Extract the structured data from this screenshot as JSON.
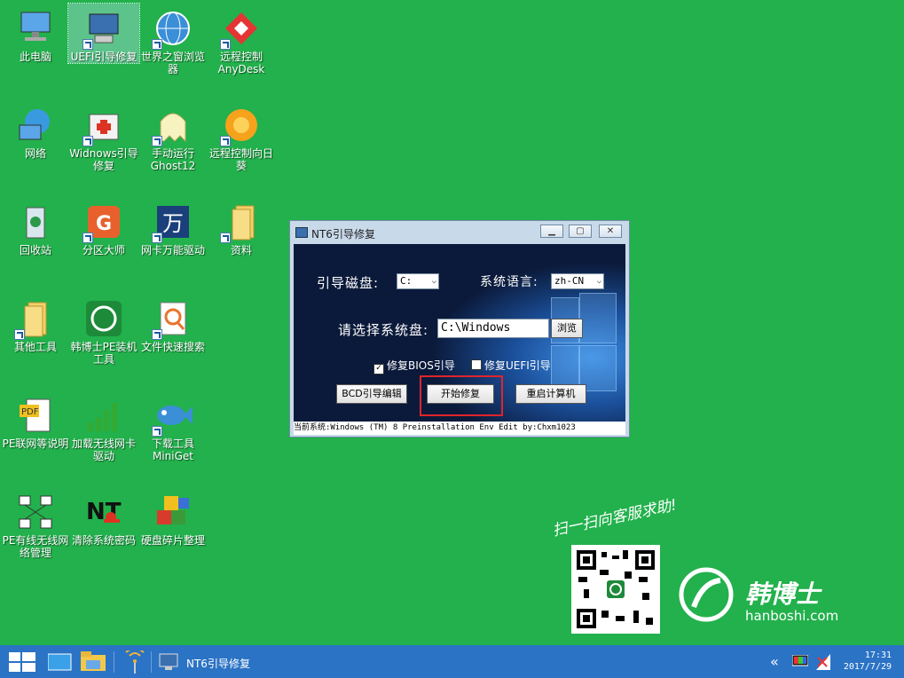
{
  "desktop": {
    "icons": [
      {
        "label": "此电脑"
      },
      {
        "label": "UEFI引导修复"
      },
      {
        "label": "世界之窗浏览器"
      },
      {
        "label": "远程控制AnyDesk"
      },
      {
        "label": "网络"
      },
      {
        "label": "Widnows引导修复"
      },
      {
        "label": "手动运行Ghost12"
      },
      {
        "label": "远程控制向日葵"
      },
      {
        "label": "回收站"
      },
      {
        "label": "分区大师"
      },
      {
        "label": "网卡万能驱动"
      },
      {
        "label": "资料"
      },
      {
        "label": "其他工具"
      },
      {
        "label": "韩博士PE装机工具"
      },
      {
        "label": "文件快速搜索"
      },
      {
        "label": "PE联网等说明"
      },
      {
        "label": "加载无线网卡驱动"
      },
      {
        "label": "下载工具MiniGet"
      },
      {
        "label": "PE有线无线网络管理"
      },
      {
        "label": "清除系统密码"
      },
      {
        "label": "硬盘碎片整理"
      }
    ]
  },
  "window": {
    "title": "NT6引导修复",
    "boot_disk_label": "引导磁盘:",
    "boot_disk_value": "C:",
    "language_label": "系统语言:",
    "language_value": "zh-CN",
    "system_disk_label": "请选择系统盘:",
    "system_disk_value": "C:\\Windows",
    "browse_label": "浏览",
    "bios_checkbox_label": "修复BIOS引导",
    "uefi_checkbox_label": "修复UEFI引导",
    "bcd_button": "BCD引导编辑",
    "start_button": "开始修复",
    "restart_button": "重启计算机",
    "status": "当前系统:Windows (TM) 8 Preinstallation Env  Edit by:Chxm1023"
  },
  "taskbar": {
    "active_task": "NT6引导修复",
    "time": "17:31",
    "date": "2017/7/29"
  },
  "branding": {
    "slogan": "扫一扫向客服求助!",
    "name": "韩博士",
    "url": "hanboshi.com"
  },
  "colors": {
    "desktop": "#22b14c",
    "taskbar": "#2b73c5",
    "highlight": "#e0242b"
  }
}
